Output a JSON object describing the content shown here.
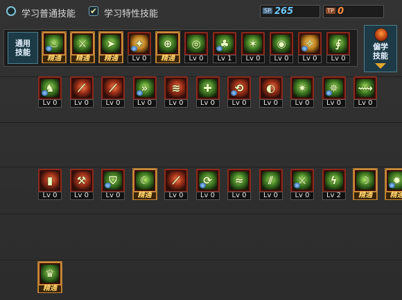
{
  "top": {
    "tab_normal": "学习普通技能",
    "tab_special": "学习特性技能",
    "sp_tag": "SP",
    "sp_value": "265",
    "tp_tag": "TP",
    "tp_value": "0"
  },
  "common": {
    "label": "通用技能",
    "skills": [
      {
        "level": "精通",
        "gold": true,
        "icon": "sitting-figure-icon",
        "sym": "♨"
      },
      {
        "level": "精通",
        "gold": true,
        "icon": "crouching-figure-icon",
        "sym": "⚔"
      },
      {
        "level": "精通",
        "gold": true,
        "icon": "running-figure-icon",
        "sym": "➤"
      },
      {
        "level": "Lv 0",
        "gold": false,
        "icon": "golden-wings-icon",
        "sym": "✦"
      },
      {
        "level": "精通",
        "gold": true,
        "icon": "target-crosshair-icon",
        "sym": "⊕"
      },
      {
        "level": "Lv 0",
        "gold": false,
        "icon": "radar-crosshair-icon",
        "sym": "◎"
      },
      {
        "level": "Lv 1",
        "gold": false,
        "icon": "mushroom-figure-icon",
        "sym": "♣"
      },
      {
        "level": "Lv 0",
        "gold": false,
        "icon": "figure-glow-icon",
        "sym": "✶"
      },
      {
        "level": "Lv 0",
        "gold": false,
        "icon": "eye-vortex-icon",
        "sym": "◉"
      },
      {
        "level": "Lv 0",
        "gold": false,
        "icon": "golden-figure-icon",
        "sym": "✧"
      },
      {
        "level": "Lv 0",
        "gold": false,
        "icon": "spiral-staff-icon",
        "sym": "∮"
      }
    ]
  },
  "special": {
    "label": "偏学技能"
  },
  "rows": [
    {
      "skills": [
        {
          "level": "Lv 0",
          "gold": false,
          "icon": "green-flame-figure-icon",
          "sym": "♞"
        },
        {
          "level": "Lv 0",
          "gold": false,
          "icon": "red-claw-slash-icon",
          "sym": "⟋"
        },
        {
          "level": "Lv 0",
          "gold": false,
          "icon": "red-blade-slash-icon",
          "sym": "⟋"
        },
        {
          "level": "Lv 0",
          "gold": false,
          "icon": "triple-arrow-icon",
          "sym": "»"
        },
        {
          "level": "Lv 0",
          "gold": false,
          "icon": "red-sweep-slash-icon",
          "sym": "≋"
        },
        {
          "level": "Lv 0",
          "gold": false,
          "icon": "cross-shield-icon",
          "sym": "✚"
        },
        {
          "level": "Lv 0",
          "gold": false,
          "icon": "red-swirl-icon",
          "sym": "⟲"
        },
        {
          "level": "Lv 0",
          "gold": false,
          "icon": "red-ring-slash-icon",
          "sym": "◐"
        },
        {
          "level": "Lv 0",
          "gold": false,
          "icon": "burst-strike-icon",
          "sym": "✷"
        },
        {
          "level": "Lv 0",
          "gold": false,
          "icon": "crystal-burst-icon",
          "sym": "✵"
        },
        {
          "level": "Lv 0",
          "gold": false,
          "icon": "green-dash-icon",
          "sym": "⟿"
        }
      ]
    },
    {
      "skills": [
        {
          "level": "Lv 0",
          "gold": false,
          "icon": "red-block-icon",
          "sym": "▮"
        },
        {
          "level": "Lv 0",
          "gold": false,
          "icon": "red-warrior-icon",
          "sym": "⚒"
        },
        {
          "level": "Lv 0",
          "gold": false,
          "icon": "gate-shield-icon",
          "sym": "⛉"
        },
        {
          "level": "精通",
          "gold": true,
          "icon": "green-crescent-slash-icon",
          "sym": "☾"
        },
        {
          "level": "Lv 0",
          "gold": false,
          "icon": "red-dive-icon",
          "sym": "⟋"
        },
        {
          "level": "Lv 0",
          "gold": false,
          "icon": "green-spin-icon",
          "sym": "⟳"
        },
        {
          "level": "Lv 0",
          "gold": false,
          "icon": "green-wave-icon",
          "sym": "≈"
        },
        {
          "level": "Lv 0",
          "gold": false,
          "icon": "green-blades-icon",
          "sym": "⫽"
        },
        {
          "level": "Lv 0",
          "gold": false,
          "icon": "twin-swords-icon",
          "sym": "⚔"
        },
        {
          "level": "Lv 2",
          "gold": false,
          "icon": "green-lightning-icon",
          "sym": "ϟ"
        },
        {
          "level": "精通",
          "gold": true,
          "icon": "crescent-moon-icon",
          "sym": "☽"
        },
        {
          "level": "精通",
          "gold": true,
          "icon": "green-star-burst-icon",
          "sym": "✹"
        }
      ]
    },
    {
      "skills": [
        {
          "level": "精通",
          "gold": true,
          "icon": "green-dragon-icon",
          "sym": "♛"
        }
      ]
    }
  ]
}
